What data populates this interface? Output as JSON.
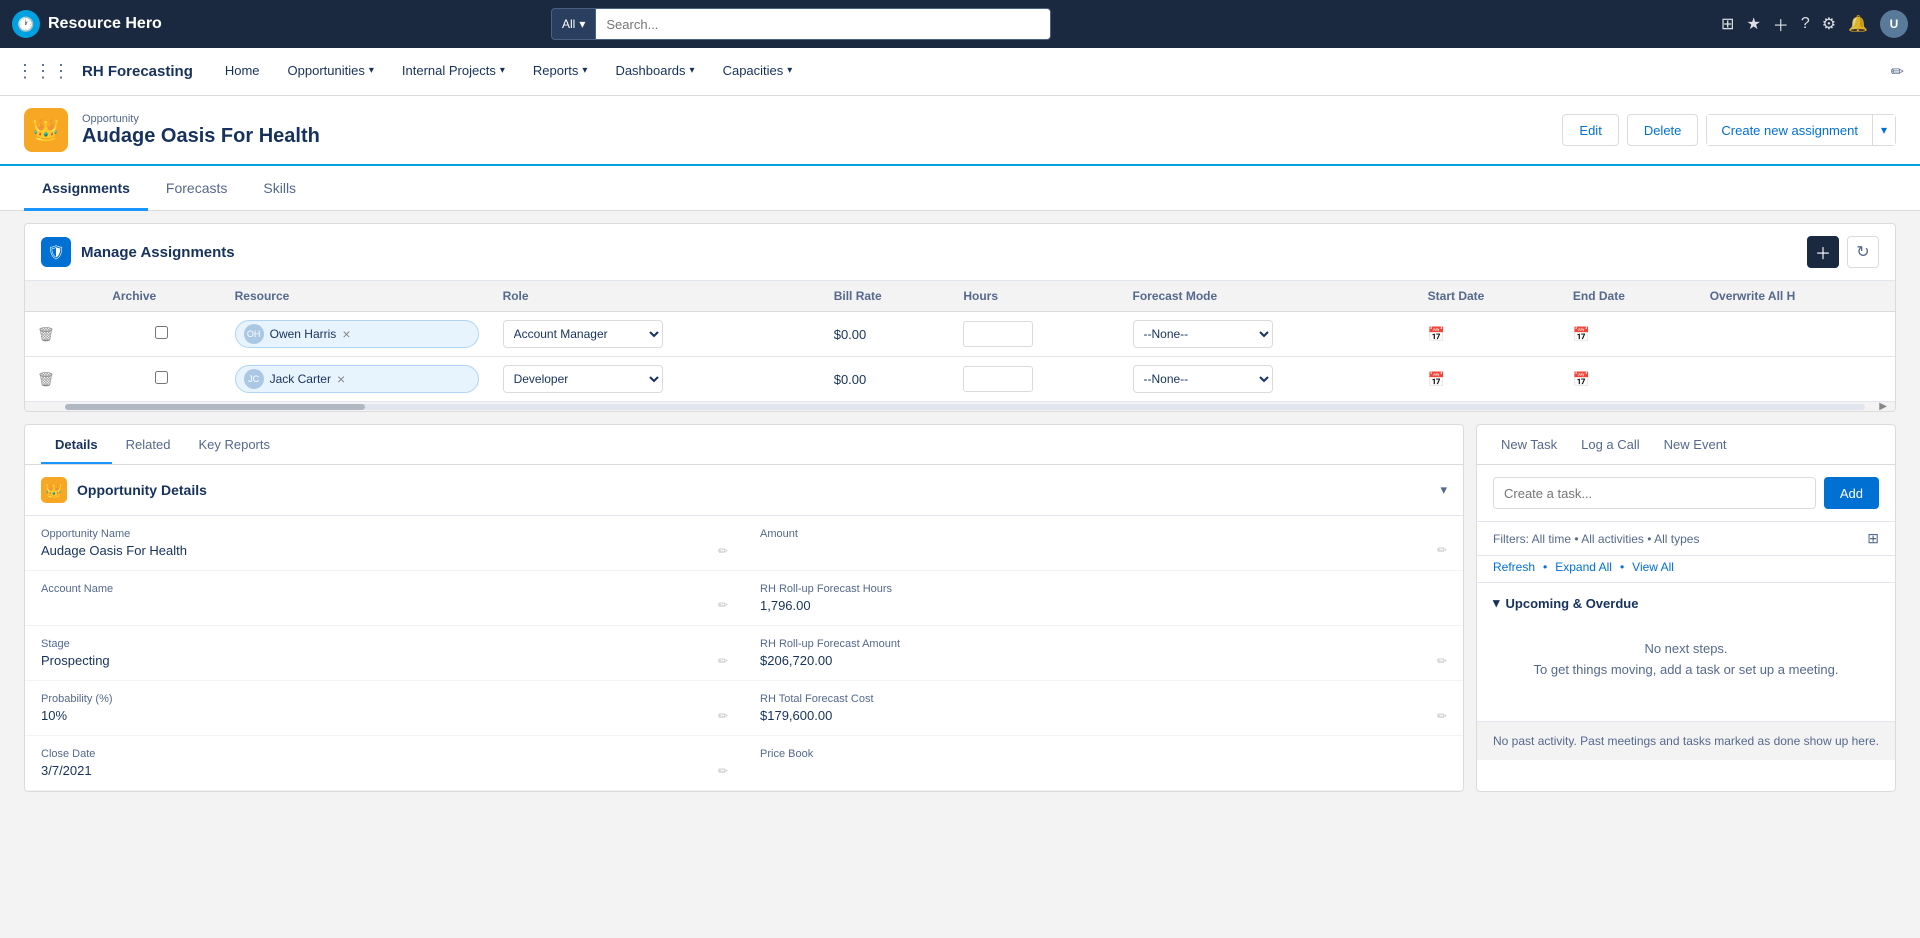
{
  "topbar": {
    "logo_text": "Resource Hero",
    "search_placeholder": "Search...",
    "search_all_label": "All"
  },
  "menubar": {
    "app_name": "RH Forecasting",
    "items": [
      {
        "label": "Home",
        "active": false
      },
      {
        "label": "Opportunities",
        "active": false,
        "has_chevron": true
      },
      {
        "label": "Internal Projects",
        "active": false,
        "has_chevron": true
      },
      {
        "label": "Reports",
        "active": false,
        "has_chevron": true
      },
      {
        "label": "Dashboards",
        "active": false,
        "has_chevron": true
      },
      {
        "label": "Capacities",
        "active": false,
        "has_chevron": true
      }
    ]
  },
  "record_header": {
    "breadcrumb": "Opportunity",
    "title": "Audage Oasis For Health",
    "edit_label": "Edit",
    "delete_label": "Delete",
    "create_assignment_label": "Create new assignment"
  },
  "tabs": [
    {
      "label": "Assignments",
      "active": true
    },
    {
      "label": "Forecasts",
      "active": false
    },
    {
      "label": "Skills",
      "active": false
    }
  ],
  "manage_assignments": {
    "title": "Manage Assignments",
    "columns": [
      "Archive",
      "Resource",
      "Role",
      "Bill Rate",
      "Hours",
      "Forecast Mode",
      "Start Date",
      "End Date",
      "Overwrite All H"
    ],
    "rows": [
      {
        "resource": "Owen Harris",
        "role": "Account Manager",
        "bill_rate": "$0.00",
        "hours": "",
        "forecast_mode": "--None--",
        "start_date": "",
        "end_date": ""
      },
      {
        "resource": "Jack Carter",
        "role": "Developer",
        "bill_rate": "$0.00",
        "hours": "",
        "forecast_mode": "--None--",
        "start_date": "",
        "end_date": ""
      }
    ]
  },
  "bottom_tabs": [
    {
      "label": "Details",
      "active": true
    },
    {
      "label": "Related",
      "active": false
    },
    {
      "label": "Key Reports",
      "active": false
    }
  ],
  "opportunity_details": {
    "section_title": "Opportunity Details",
    "fields": {
      "opp_name_label": "Opportunity Name",
      "opp_name_value": "Audage Oasis For Health",
      "amount_label": "Amount",
      "amount_value": "",
      "account_name_label": "Account Name",
      "account_name_value": "",
      "rh_hours_label": "RH Roll-up Forecast Hours",
      "rh_hours_value": "1,796.00",
      "stage_label": "Stage",
      "stage_value": "Prospecting",
      "rh_amount_label": "RH Roll-up Forecast Amount",
      "rh_amount_value": "$206,720.00",
      "probability_label": "Probability (%)",
      "probability_value": "10%",
      "rh_cost_label": "RH Total Forecast Cost",
      "rh_cost_value": "$179,600.00",
      "close_date_label": "Close Date",
      "close_date_value": "3/7/2021",
      "price_book_label": "Price Book",
      "price_book_value": ""
    }
  },
  "right_panel": {
    "tabs": [
      {
        "label": "New Task",
        "active": false
      },
      {
        "label": "Log a Call",
        "active": false
      },
      {
        "label": "New Event",
        "active": false
      }
    ],
    "task_placeholder": "Create a task...",
    "add_label": "Add",
    "filters_text": "Filters: All time • All activities • All types",
    "refresh_text": "Refresh",
    "expand_all_text": "Expand All",
    "view_all_text": "View All",
    "upcoming_title": "Upcoming & Overdue",
    "no_steps_line1": "No next steps.",
    "no_steps_line2": "To get things moving, add a task or set up a meeting.",
    "no_past_text": "No past activity. Past meetings and tasks marked as done show up here."
  }
}
